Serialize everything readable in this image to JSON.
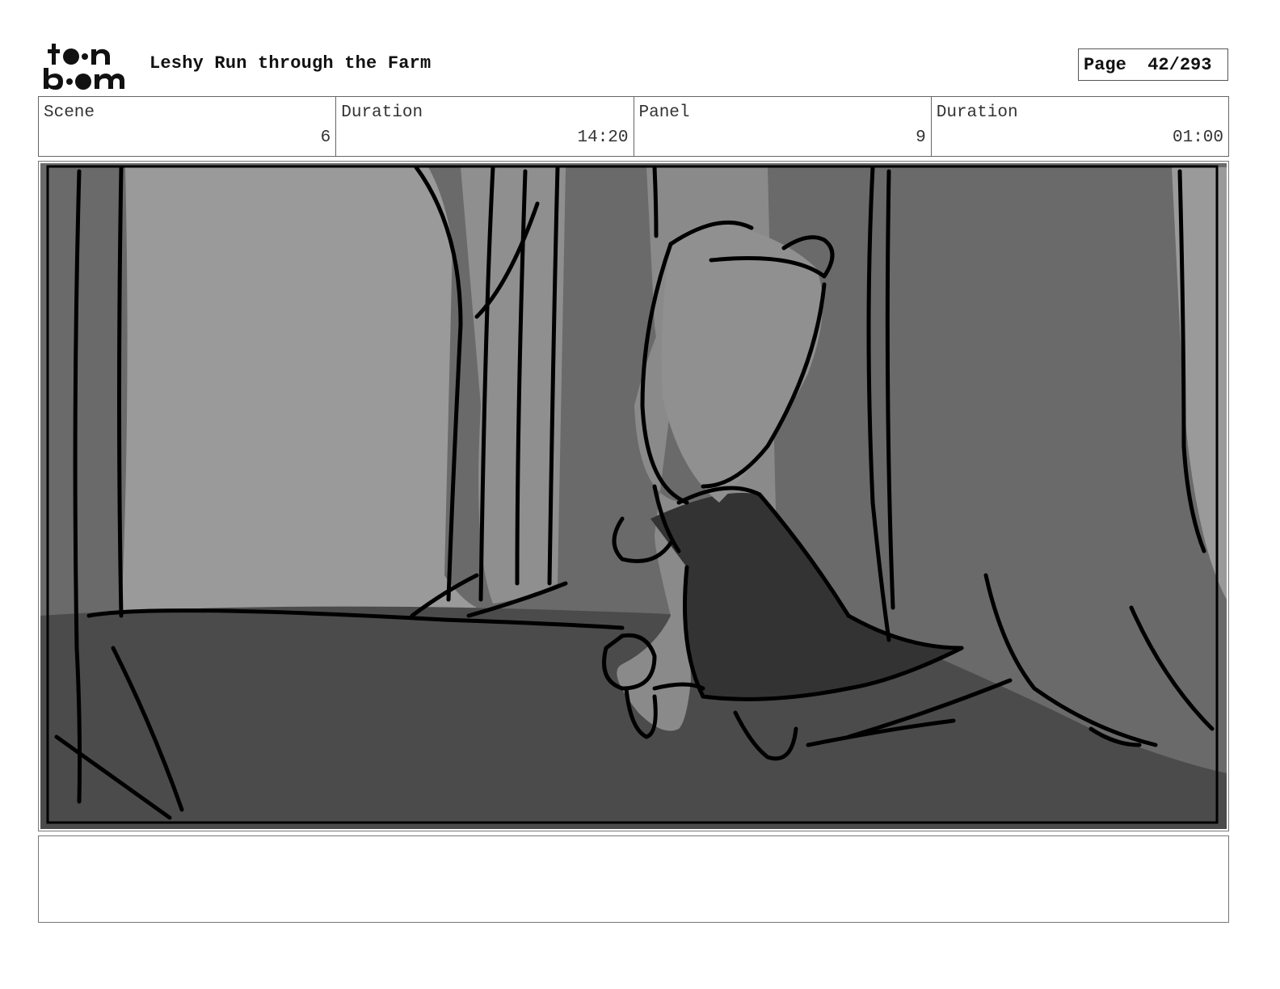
{
  "header": {
    "logo_text": "toon boom",
    "project_title": "Leshy Run through the Farm",
    "page_indicator": "Page  42/293"
  },
  "info": {
    "scene_label": "Scene",
    "scene_value": "6",
    "scene_duration_label": "Duration",
    "scene_duration_value": "14:20",
    "panel_label": "Panel",
    "panel_value": "9",
    "panel_duration_label": "Duration",
    "panel_duration_value": "01:00"
  },
  "notes": {
    "text": ""
  },
  "colors": {
    "sky_light": "#9a9a9a",
    "tree_mid": "#6a6a6a",
    "ground_dark": "#4b4b4b",
    "cape_dark": "#333333",
    "ink": "#000000"
  }
}
